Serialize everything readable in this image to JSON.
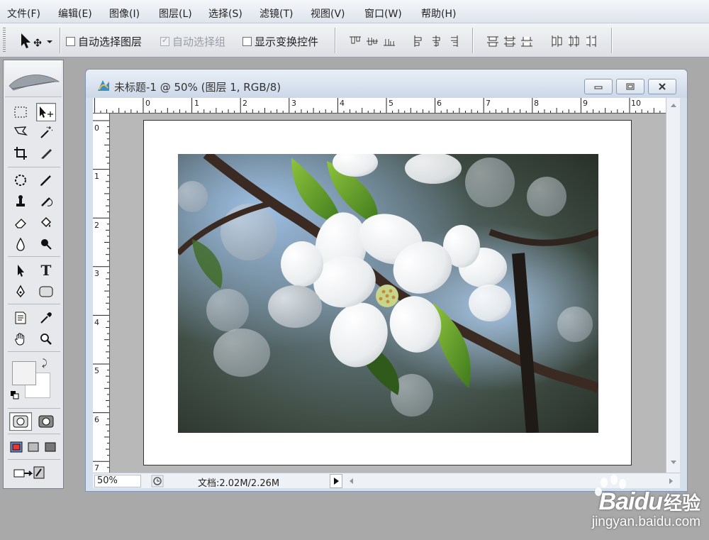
{
  "menu": [
    "文件(F)",
    "编辑(E)",
    "图像(I)",
    "图层(L)",
    "选择(S)",
    "滤镜(T)",
    "视图(V)",
    "窗口(W)",
    "帮助(H)"
  ],
  "options": {
    "auto_select_layer": "自动选择图层",
    "auto_select_group": "自动选择组",
    "show_transform": "显示变换控件"
  },
  "document": {
    "title": "未标题-1 @ 50% (图层 1, RGB/8)",
    "zoom": "50%",
    "doc_info": "文档:2.02M/2.26M",
    "ruler_h": [
      "0",
      "1",
      "2",
      "3",
      "4",
      "5",
      "6",
      "7",
      "8",
      "9",
      "10"
    ],
    "ruler_v": [
      "0",
      "1",
      "2",
      "3",
      "4",
      "5",
      "6",
      "7"
    ]
  },
  "watermark": {
    "brand": "Baidu",
    "brand_cn": "经验",
    "url": "jingyan.baidu.com"
  },
  "colors": {
    "menubar": "#e8ecf2",
    "workspace": "#a9a9a9",
    "window_frame": "#d6dfec"
  }
}
